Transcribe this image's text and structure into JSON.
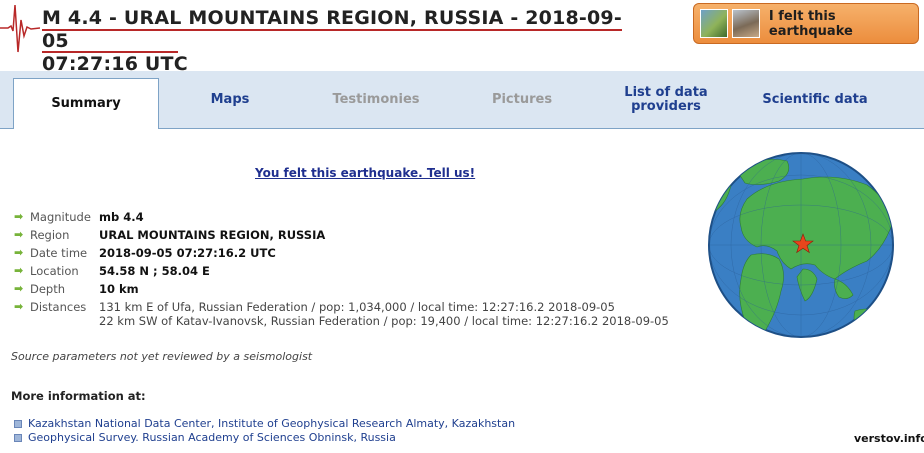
{
  "header": {
    "title_line1": "M 4.4 - URAL MOUNTAINS REGION, RUSSIA - 2018-09-05",
    "title_line2": "07:27:16 UTC",
    "felt_button_label": "I felt this earthquake"
  },
  "tabs": [
    {
      "label": "Summary",
      "state": "active"
    },
    {
      "label": "Maps",
      "state": "enabled"
    },
    {
      "label": "Testimonies",
      "state": "disabled"
    },
    {
      "label": "Pictures",
      "state": "disabled"
    },
    {
      "label": "List of data providers",
      "state": "enabled"
    },
    {
      "label": "Scientific data",
      "state": "enabled"
    }
  ],
  "tell_us_link": "You felt this earthquake. Tell us!",
  "params": {
    "magnitude": {
      "label": "Magnitude",
      "value": "mb 4.4"
    },
    "region": {
      "label": "Region",
      "value": "URAL MOUNTAINS REGION, RUSSIA"
    },
    "datetime": {
      "label": "Date time",
      "value": "2018-09-05 07:27:16.2 UTC"
    },
    "location": {
      "label": "Location",
      "value": "54.58 N ; 58.04 E"
    },
    "depth": {
      "label": "Depth",
      "value": "10 km"
    },
    "distances": {
      "label": "Distances",
      "line1": "131 km E of Ufa, Russian Federation / pop: 1,034,000 / local time: 12:27:16.2 2018-09-05",
      "line2": "22 km SW of Katav-Ivanovsk, Russian Federation / pop: 19,400 / local time: 12:27:16.2 2018-09-05"
    }
  },
  "review_note": "Source parameters not yet reviewed by a seismologist",
  "more_info": {
    "heading": "More information at:",
    "links": [
      "Kazakhstan National Data Center, Institute of Geophysical Research Almaty, Kazakhstan",
      "Geophysical Survey. Russian Academy of Sciences Obninsk, Russia"
    ]
  },
  "watermark": "verstov.info",
  "colors": {
    "accent_red": "#b82828",
    "tab_bg": "#dbe6f2",
    "link_blue": "#1f3f8f",
    "button_orange": "#ec8d3d",
    "arrow_green": "#77b33a",
    "ocean": "#3a7fc4",
    "land": "#4caf50",
    "epicenter_star": "#e8461c"
  },
  "icons": {
    "param_bullet": "green-arrow-icon",
    "link_bullet": "square-bullet-icon",
    "epicenter": "star-icon"
  }
}
